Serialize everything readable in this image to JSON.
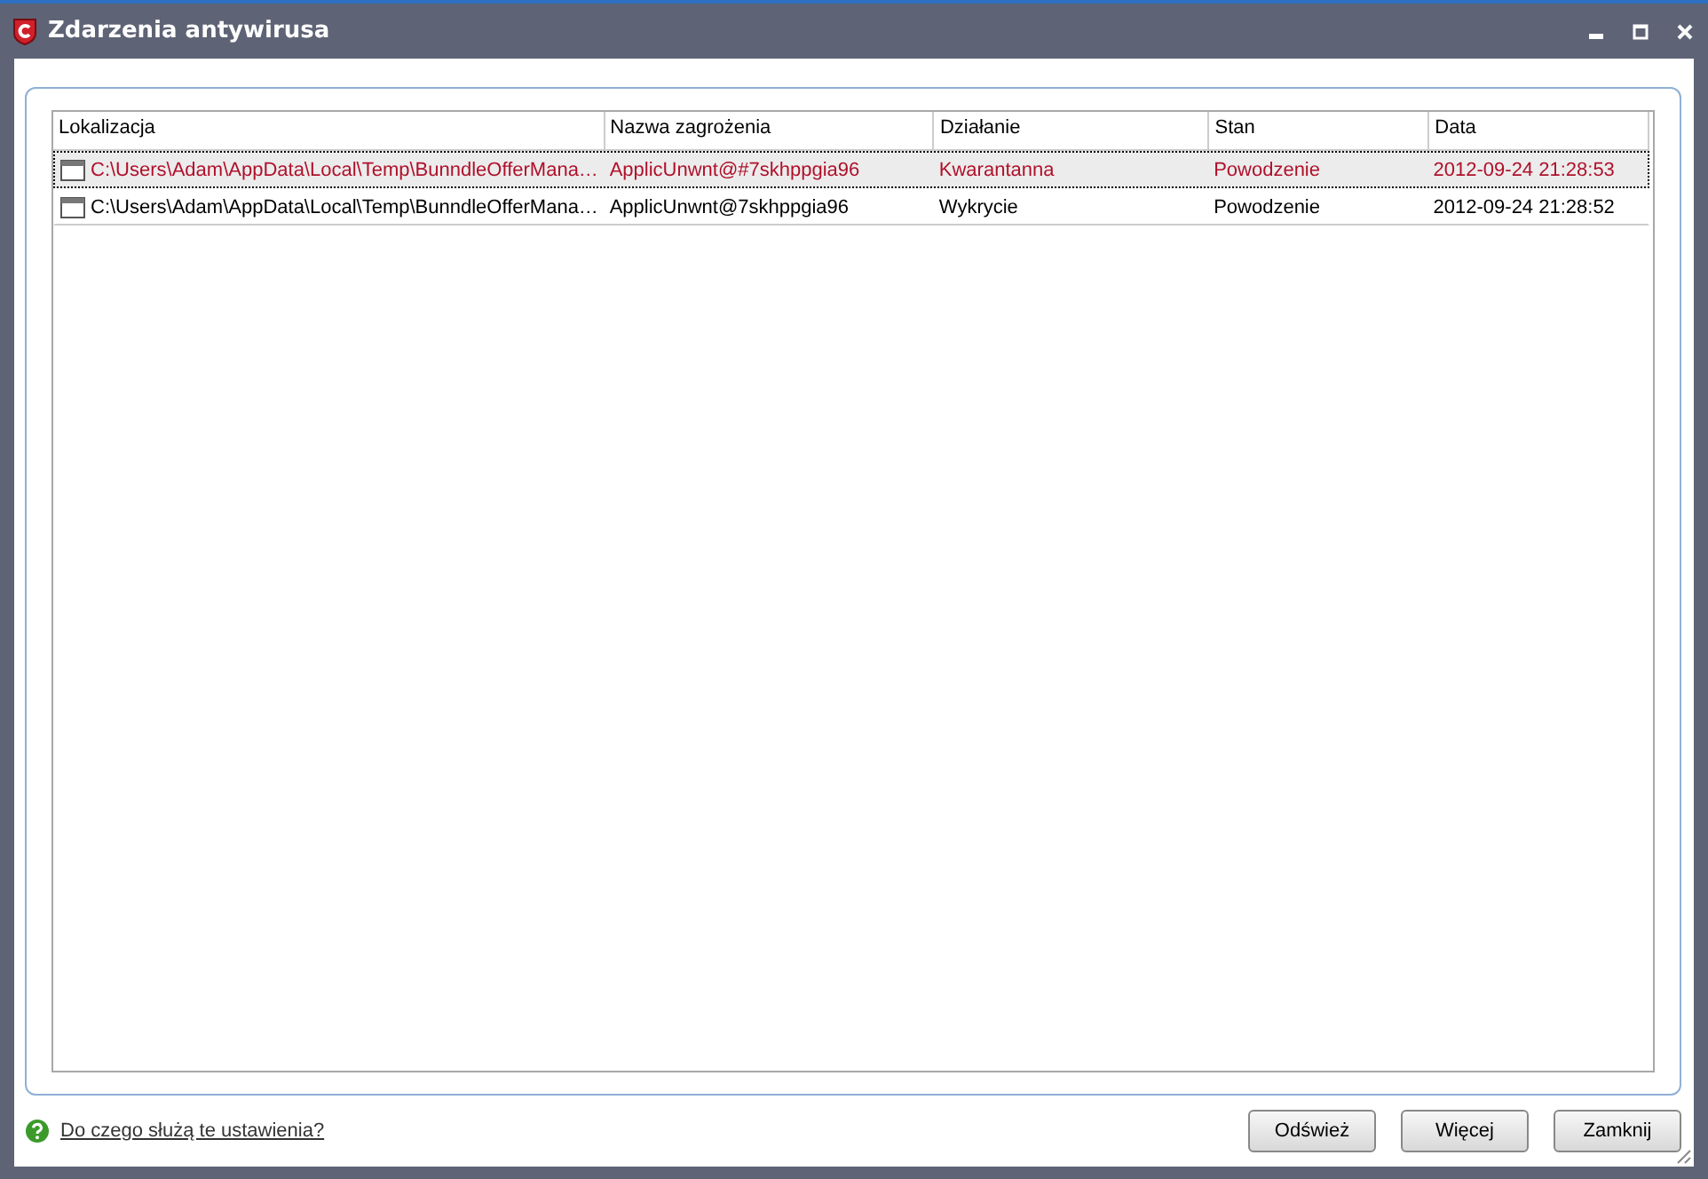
{
  "window": {
    "title": "Zdarzenia antywirusa"
  },
  "table": {
    "columns": [
      "Lokalizacja",
      "Nazwa zagrożenia",
      "Działanie",
      "Stan",
      "Data"
    ],
    "rows": [
      {
        "selected": true,
        "cells": [
          "C:\\Users\\Adam\\AppData\\Local\\Temp\\BunndleOfferMana…",
          "ApplicUnwnt@#7skhppgia96",
          "Kwarantanna",
          "Powodzenie",
          "2012-09-24 21:28:53"
        ]
      },
      {
        "selected": false,
        "cells": [
          "C:\\Users\\Adam\\AppData\\Local\\Temp\\BunndleOfferMana…",
          "ApplicUnwnt@7skhppgia96",
          "Wykrycie",
          "Powodzenie",
          "2012-09-24 21:28:52"
        ]
      }
    ]
  },
  "help_link": "Do czego służą te ustawienia?",
  "buttons": [
    "Odśwież",
    "Więcej",
    "Zamknij"
  ]
}
